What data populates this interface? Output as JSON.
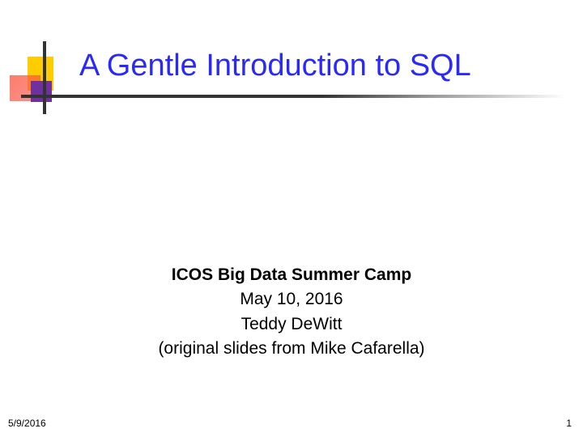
{
  "slide": {
    "title": "A Gentle Introduction to SQL",
    "subtitle": {
      "heading": "ICOS Big Data Summer Camp",
      "date": "May 10, 2016",
      "author": "Teddy DeWitt",
      "attribution": "(original slides from Mike Cafarella)"
    },
    "footer": {
      "date": "5/9/2016",
      "page_number": "1"
    }
  }
}
